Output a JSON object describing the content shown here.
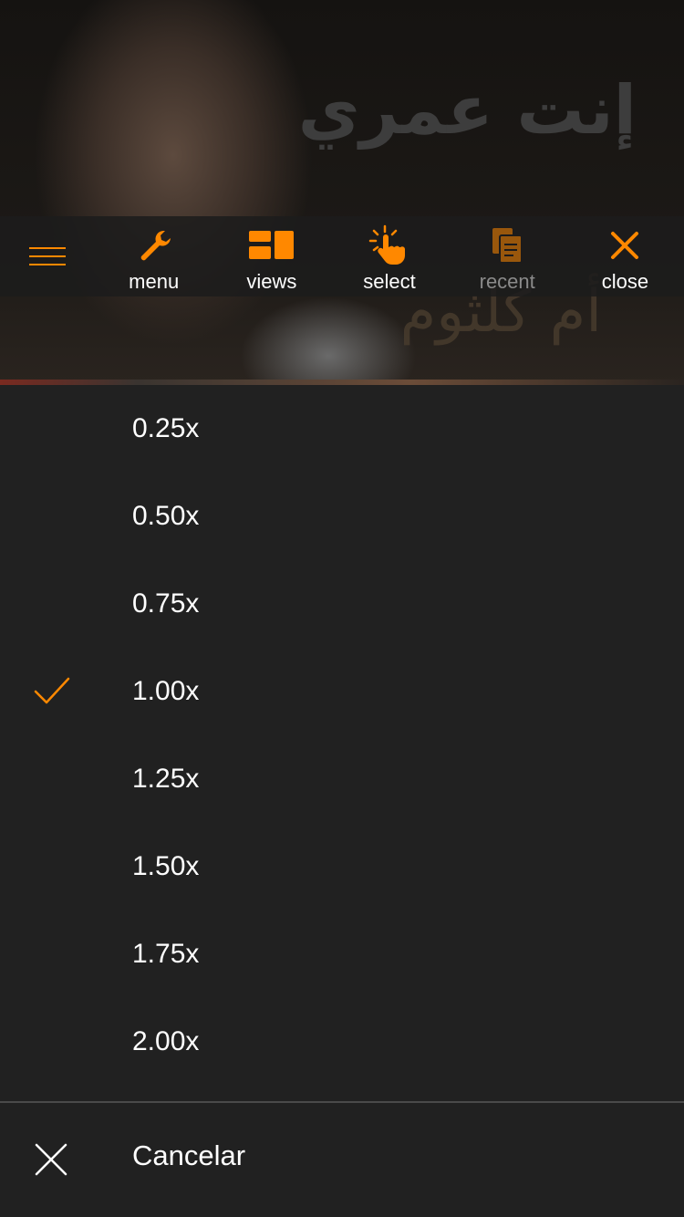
{
  "video": {
    "title_arabic": "إنت عمري",
    "subtitle_arabic": "أم كلثوم"
  },
  "toolbar": {
    "accent_color": "#ff8800",
    "items": [
      {
        "label": "menu",
        "icon": "wrench-icon"
      },
      {
        "label": "views",
        "icon": "views-icon"
      },
      {
        "label": "select",
        "icon": "tap-hand-icon"
      },
      {
        "label": "recent",
        "icon": "documents-icon"
      },
      {
        "label": "close",
        "icon": "close-icon"
      }
    ]
  },
  "speed_menu": {
    "selected": "1.00x",
    "check_color": "#ff8800",
    "options": [
      {
        "label": "0.25x"
      },
      {
        "label": "0.50x"
      },
      {
        "label": "0.75x"
      },
      {
        "label": "1.00x",
        "selected": true
      },
      {
        "label": "1.25x"
      },
      {
        "label": "1.50x"
      },
      {
        "label": "1.75x"
      },
      {
        "label": "2.00x"
      }
    ],
    "cancel_label": "Cancelar"
  }
}
